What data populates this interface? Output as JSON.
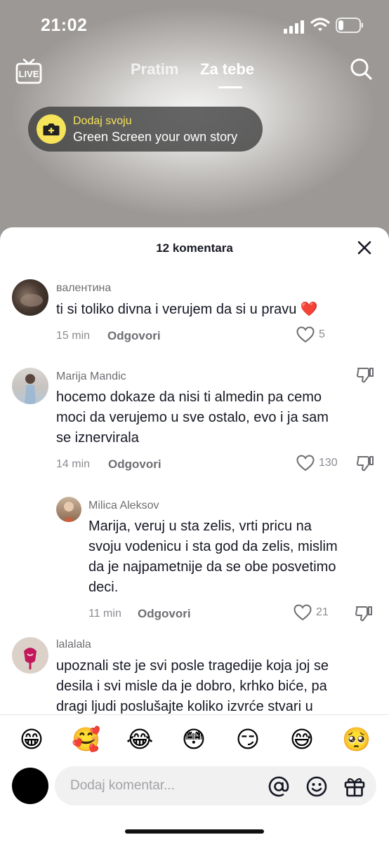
{
  "status_bar": {
    "time": "21:02"
  },
  "top_nav": {
    "live_label": "LIVE",
    "tabs": [
      {
        "label": "Pratim",
        "active": false
      },
      {
        "label": "Za tebe",
        "active": true
      }
    ]
  },
  "greenscreen": {
    "title": "Dodaj svoju",
    "subtitle": "Green Screen your own story"
  },
  "sheet": {
    "count_label": "12 komentara"
  },
  "comments": [
    {
      "username": "валентина",
      "text_lines": [
        "ti si toliko divna i verujem da si u pravu ❤️"
      ],
      "time": "15 min",
      "reply_label": "Odgovori",
      "likes": "5"
    },
    {
      "username": "Marija Mandic",
      "text_lines": [
        "hocemo dokaze da nisi ti almedin pa cemo",
        "moci da verujemo u sve ostalo, evo i ja sam",
        "se iznervirala"
      ],
      "time": "14 min",
      "reply_label": "Odgovori",
      "likes": "130"
    },
    {
      "username": "Milica Aleksov",
      "text_lines": [
        "Marija, veruj u sta zelis, vrti pricu na",
        "svoju vodenicu i sta god da zelis, mislim",
        "da je najpametnije da se obe posvetimo",
        "deci."
      ],
      "time": "11 min",
      "reply_label": "Odgovori",
      "likes": "21"
    },
    {
      "username": "lalalala",
      "text_lines": [
        "upoznali ste je svi posle tragedije koja joj se",
        "desila i svi misle da je dobro, krhko biće, pa",
        "dragi ljudi poslušajte koliko izvrće stvari u"
      ]
    }
  ],
  "emojis": [
    "😁",
    "🥰",
    "😂",
    "😳",
    "😏",
    "😅",
    "🥺"
  ],
  "input": {
    "placeholder": "Dodaj komentar..."
  },
  "colors": {
    "accent_yellow": "#f6e35a",
    "heart_red": "#fe2c55"
  }
}
